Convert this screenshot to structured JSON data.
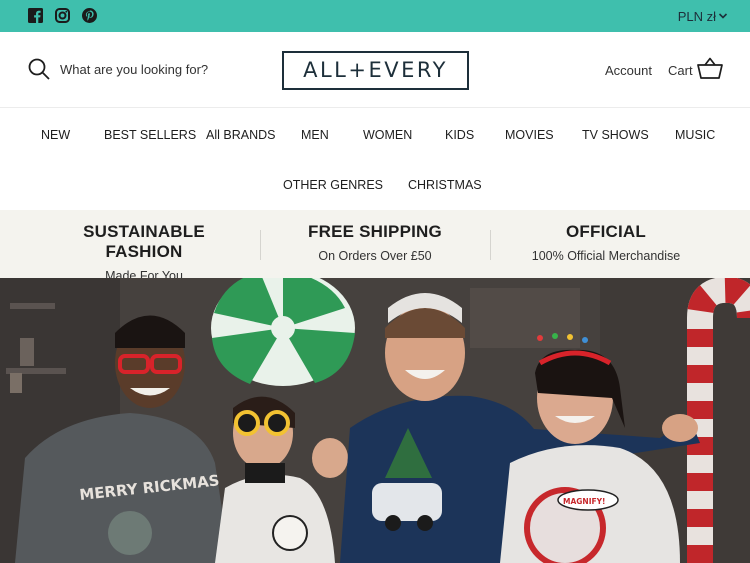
{
  "topbar": {
    "social": [
      "facebook-icon",
      "instagram-icon",
      "pinterest-icon"
    ],
    "currency": "PLN zł",
    "background": "#3fbfad"
  },
  "header": {
    "search_placeholder": "What are you looking for?",
    "logo": "ALL+EVERY",
    "account": "Account",
    "cart": "Cart"
  },
  "nav": {
    "items": [
      "NEW",
      "BEST SELLERS",
      "All BRANDS",
      "MEN",
      "WOMEN",
      "KIDS",
      "MOVIES",
      "TV SHOWS",
      "MUSIC",
      "OTHER GENRES",
      "CHRISTMAS"
    ]
  },
  "features": [
    {
      "title": "SUSTAINABLE FASHION",
      "subtitle": "Made For You"
    },
    {
      "title": "FREE SHIPPING",
      "subtitle": "On Orders Over £50"
    },
    {
      "title": "OFFICIAL",
      "subtitle": "100% Official Merchandise"
    }
  ],
  "hero": {
    "sweater_texts": [
      "MERRY RICKMAS",
      "MAGNIFY!"
    ]
  },
  "colors": {
    "accent": "#3fbfad",
    "navy": "#1d2f3a",
    "features_bg": "#f4f3ee"
  }
}
